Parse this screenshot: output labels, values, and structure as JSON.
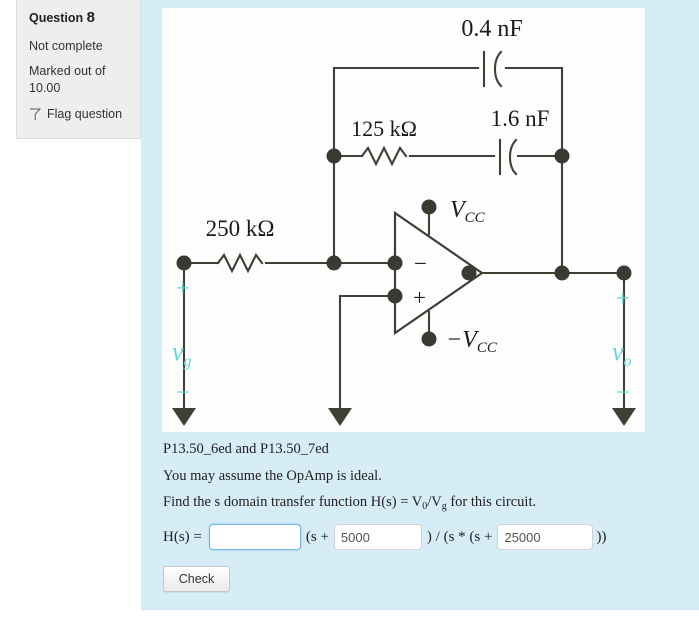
{
  "question_info": {
    "title_label": "Question",
    "number": "8",
    "status": "Not complete",
    "marked_line1": "Marked out of",
    "marked_line2": "10.00",
    "flag_label": "Flag question",
    "flag_icon": "flag-icon"
  },
  "circuit": {
    "alt": "Op-amp circuit with 250 kΩ input resistor, 125 kΩ feedback resistor, 1.6 nF and 0.4 nF feedback capacitors",
    "labels": {
      "cap_top": "0.4 nF",
      "res_feedback": "125 kΩ",
      "cap_feedback": "1.6 nF",
      "res_input": "250 kΩ",
      "vcc_pos": "V",
      "vcc_pos_sub": "CC",
      "vcc_neg": "−V",
      "vcc_neg_sub": "CC",
      "inv_input": "−",
      "noninv_input": "+",
      "vg_plus": "+",
      "vg_name": "v",
      "vg_sub": "g",
      "vg_minus": "−",
      "vo_plus": "+",
      "vo_name": "v",
      "vo_sub": "o",
      "vo_minus": "−"
    },
    "colors": {
      "wire": "#3d4035",
      "node": "#3a3a33",
      "annotation": "#63d4d8",
      "background": "#fdfdfd"
    }
  },
  "prose": {
    "line1": "P13.50_6ed and P13.50_7ed",
    "line2": "You may assume the OpAmp is ideal.",
    "line3_a": "Find the s domain transfer function H(s) = V",
    "line3_sub1": "0",
    "line3_b": "/V",
    "line3_sub2": "g",
    "line3_c": " for this circuit."
  },
  "answer": {
    "label": "H(s) =",
    "field1_value": "",
    "field1_placeholder": "",
    "op1": "(s +",
    "field2_value": "5000",
    "op2": ") / (s * (s +",
    "field3_value": "25000",
    "op3": "))"
  },
  "check_button": {
    "label": "Check"
  },
  "theme": {
    "panel_background": "#d6ecf7",
    "info_background": "#eeeeee",
    "focus_border": "#72b7e0"
  }
}
